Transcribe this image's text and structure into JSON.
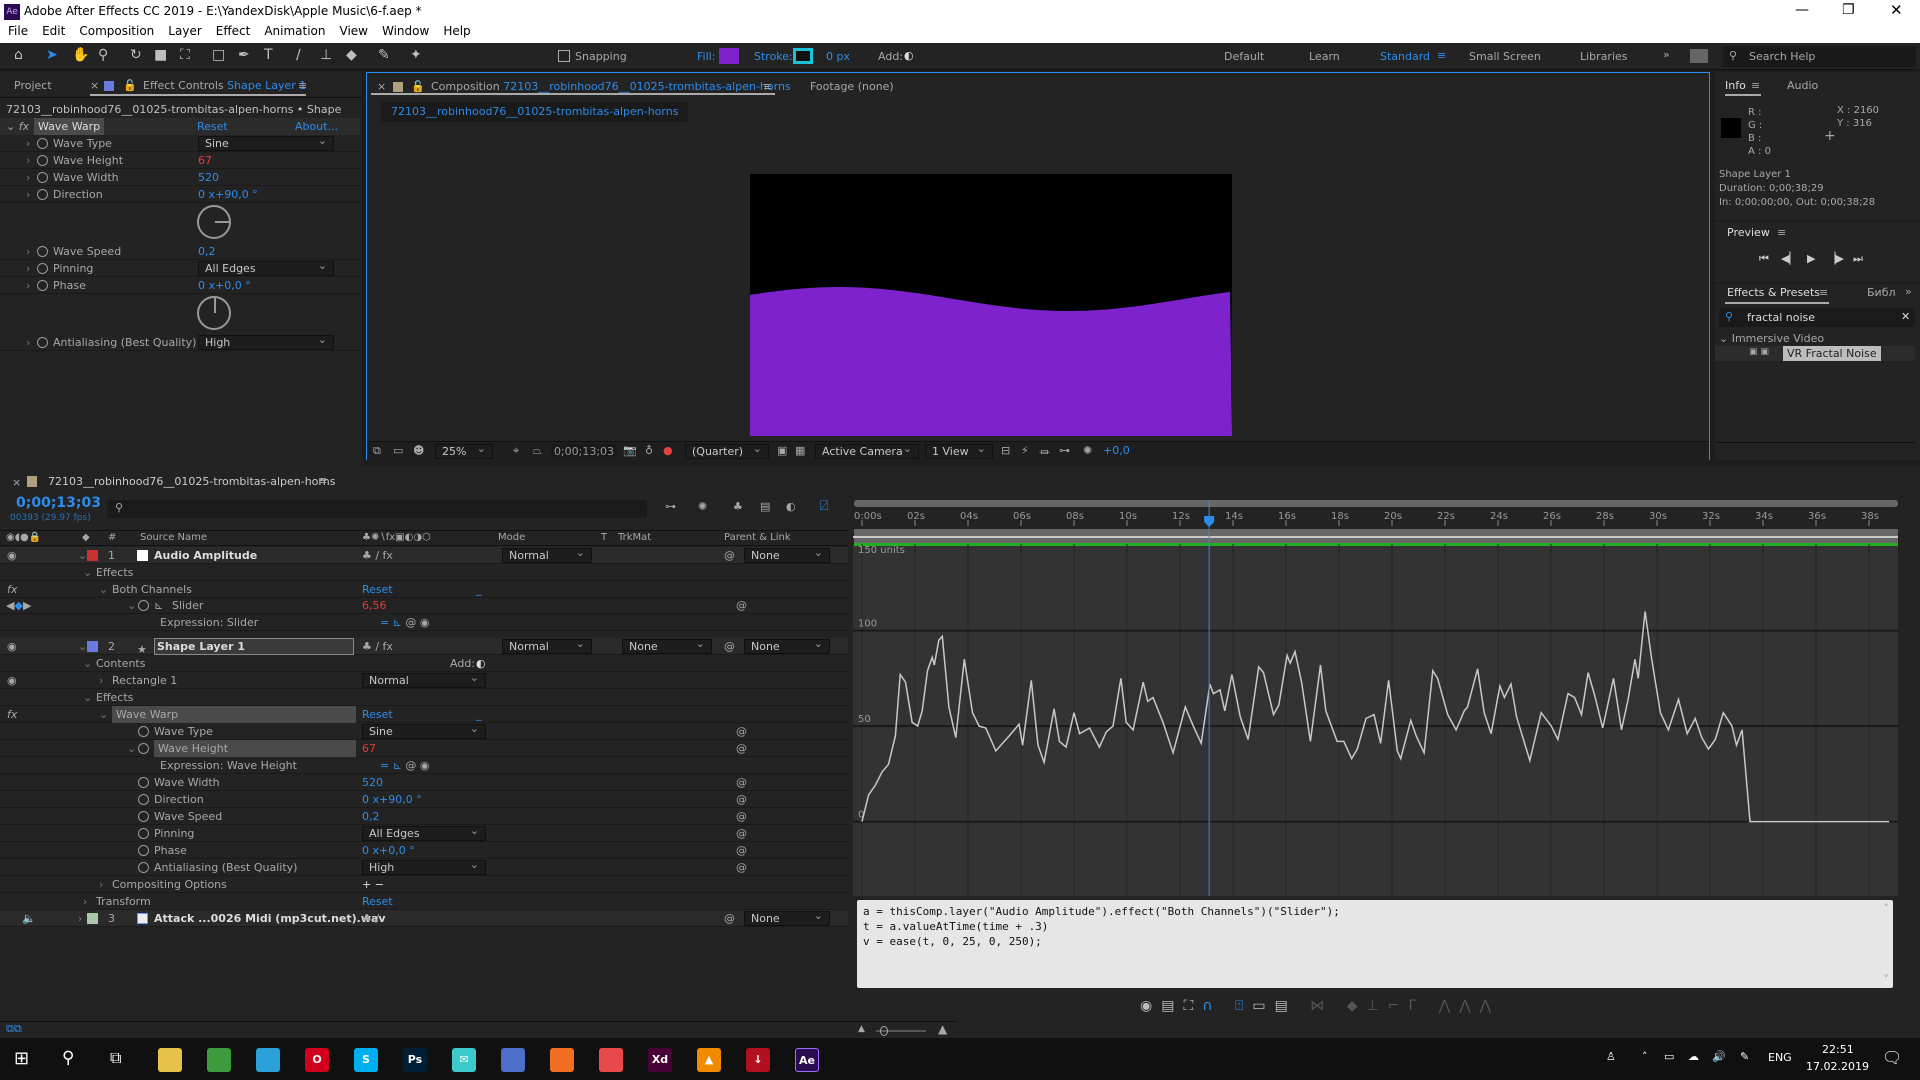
{
  "window": {
    "title": "Adobe After Effects CC 2019 - E:\\YandexDisk\\Apple Music\\6-f.aep *",
    "app_icon": "Ae"
  },
  "menu": [
    "File",
    "Edit",
    "Composition",
    "Layer",
    "Effect",
    "Animation",
    "View",
    "Window",
    "Help"
  ],
  "toolbar": {
    "snapping": "Snapping",
    "fill_label": "Fill:",
    "fill_color": "#7d22cc",
    "stroke_label": "Stroke:",
    "stroke_color": "#19c2d6",
    "stroke_width": "0 px",
    "add_label": "Add:",
    "workspaces": [
      "Default",
      "Learn",
      "Standard",
      "Small Screen",
      "Libraries"
    ],
    "active_workspace": "Standard",
    "search_help": "Search Help"
  },
  "effect_controls": {
    "tab_project": "Project",
    "tab_label": "Effect Controls",
    "tab_layer": "Shape Layer 1",
    "breadcrumb": "72103__robinhood76__01025-trombitas-alpen-horns • Shape Layer 1",
    "effect": "Wave Warp",
    "reset": "Reset",
    "about": "About...",
    "props": [
      {
        "name": "Wave Type",
        "value": "Sine",
        "kind": "dropdown"
      },
      {
        "name": "Wave Height",
        "value": "67",
        "kind": "red"
      },
      {
        "name": "Wave Width",
        "value": "520",
        "kind": "num"
      },
      {
        "name": "Direction",
        "value": "0 x+90,0 °",
        "kind": "num"
      },
      {
        "name": "Wave Speed",
        "value": "0,2",
        "kind": "num"
      },
      {
        "name": "Pinning",
        "value": "All Edges",
        "kind": "dropdown"
      },
      {
        "name": "Phase",
        "value": "0 x+0,0 °",
        "kind": "num"
      },
      {
        "name": "Antialiasing (Best Quality)",
        "value": "High",
        "kind": "dropdown"
      }
    ]
  },
  "composition": {
    "tab_label": "Composition",
    "comp_name": "72103__robinhood76__01025-trombitas-alpen-horns",
    "footage_tab": "Footage (none)",
    "wave_color": "#7d22cc",
    "zoom": "25%",
    "timecode": "0;00;13;03",
    "resolution": "(Quarter)",
    "camera": "Active Camera",
    "views": "1 View",
    "exposure": "+0,0"
  },
  "info": {
    "tab": "Info",
    "tab2": "Audio",
    "r": "R :",
    "g": "G :",
    "b": "B :",
    "a": "A :  0",
    "x": "X : 2160",
    "y": "Y : 316",
    "layer": "Shape Layer 1",
    "duration": "Duration: 0;00;38;29",
    "inout": "In: 0;00;00;00, Out: 0;00;38;28"
  },
  "preview": {
    "title": "Preview"
  },
  "effects_presets": {
    "tab": "Effects & Presets",
    "tab2": "Библ",
    "search": "fractal noise",
    "category": "Immersive Video",
    "item": "VR Fractal Noise"
  },
  "timeline": {
    "comp_name": "72103__robinhood76__01025-trombitas-alpen-horns",
    "timecode": "0;00;13;03",
    "frames": "00393 (29.97 fps)",
    "headers": {
      "num": "#",
      "source": "Source Name",
      "mode": "Mode",
      "t": "T",
      "trkmat": "TrkMat",
      "parent": "Parent & Link"
    },
    "rows": [
      {
        "indent": 0,
        "num": "1",
        "label_color": "#c83232",
        "name": "Audio Amplitude",
        "mode": "Normal",
        "parent": "None",
        "layer": true,
        "eye": true
      },
      {
        "indent": 1,
        "name": "Effects"
      },
      {
        "indent": 2,
        "name": "Both Channels",
        "value": "Reset",
        "vclass": "blue",
        "fx": true
      },
      {
        "indent": 3,
        "name": "Slider",
        "value": "6,56",
        "vclass": "red",
        "kf": true,
        "stopwatch": true
      },
      {
        "indent": 4,
        "name": "Expression: Slider",
        "expr": true
      },
      {
        "indent": 0,
        "num": "2",
        "label_color": "#6a7be0",
        "name": "Shape Layer 1",
        "mode": "Normal",
        "trkmat": "None",
        "parent": "None",
        "layer": true,
        "eye": true,
        "selected": true
      },
      {
        "indent": 1,
        "name": "Contents",
        "add": "Add:"
      },
      {
        "indent": 2,
        "name": "Rectangle 1",
        "dropdown": "Normal",
        "eye": true
      },
      {
        "indent": 1,
        "name": "Effects"
      },
      {
        "indent": 2,
        "name": "Wave Warp",
        "value": "Reset",
        "vclass": "blue",
        "fx": true,
        "hl": true
      },
      {
        "indent": 3,
        "name": "Wave Type",
        "dropdown": "Sine",
        "stopwatch": true
      },
      {
        "indent": 3,
        "name": "Wave Height",
        "value": "67",
        "vclass": "red",
        "stopwatch": true,
        "hl": true
      },
      {
        "indent": 4,
        "name": "Expression: Wave Height",
        "expr": true
      },
      {
        "indent": 3,
        "name": "Wave Width",
        "value": "520",
        "vclass": "blue",
        "stopwatch": true
      },
      {
        "indent": 3,
        "name": "Direction",
        "value": "0 x+90,0 °",
        "vclass": "blue",
        "stopwatch": true
      },
      {
        "indent": 3,
        "name": "Wave Speed",
        "value": "0,2",
        "vclass": "blue",
        "stopwatch": true
      },
      {
        "indent": 3,
        "name": "Pinning",
        "dropdown": "All Edges",
        "stopwatch": true
      },
      {
        "indent": 3,
        "name": "Phase",
        "value": "0 x+0,0 °",
        "vclass": "blue",
        "stopwatch": true
      },
      {
        "indent": 3,
        "name": "Antialiasing (Best Quality)",
        "dropdown": "High",
        "stopwatch": true
      },
      {
        "indent": 2,
        "name": "Compositing Options",
        "plusminus": "+ −"
      },
      {
        "indent": 1,
        "name": "Transform",
        "value": "Reset",
        "vclass": "blue"
      },
      {
        "indent": 0,
        "num": "3",
        "label_color": "#a8c8a8",
        "name": "Attack ...0026 Midi (mp3cut.net).wav",
        "parent": "None",
        "layer": true,
        "audio": true
      }
    ]
  },
  "graph": {
    "ruler_labels": [
      "0:00s",
      "02s",
      "04s",
      "06s",
      "08s",
      "10s",
      "12s",
      "14s",
      "16s",
      "18s",
      "20s",
      "22s",
      "24s",
      "26s",
      "28s",
      "30s",
      "32s",
      "34s",
      "36s",
      "38s"
    ],
    "top_label": "150 units",
    "y_labels": [
      "100",
      "50",
      "0"
    ],
    "playhead_s": 13.1,
    "curve": [
      [
        0,
        0
      ],
      [
        0.25,
        14
      ],
      [
        0.5,
        19
      ],
      [
        0.76,
        26
      ],
      [
        1.0,
        30
      ],
      [
        1.26,
        45
      ],
      [
        1.44,
        77
      ],
      [
        1.64,
        73
      ],
      [
        1.89,
        52
      ],
      [
        2.1,
        50
      ],
      [
        2.27,
        58
      ],
      [
        2.47,
        79
      ],
      [
        2.65,
        86
      ],
      [
        2.73,
        82
      ],
      [
        2.9,
        95
      ],
      [
        3.03,
        97
      ],
      [
        3.28,
        60
      ],
      [
        3.54,
        44
      ],
      [
        3.86,
        85
      ],
      [
        4.17,
        57
      ],
      [
        4.42,
        50
      ],
      [
        4.67,
        49
      ],
      [
        5.05,
        37
      ],
      [
        5.56,
        45
      ],
      [
        5.93,
        51
      ],
      [
        6.06,
        40
      ],
      [
        6.39,
        74
      ],
      [
        6.64,
        40
      ],
      [
        6.87,
        31
      ],
      [
        7.25,
        59
      ],
      [
        7.45,
        42
      ],
      [
        7.7,
        39
      ],
      [
        8.0,
        57
      ],
      [
        8.21,
        46
      ],
      [
        8.59,
        49
      ],
      [
        8.96,
        39
      ],
      [
        9.22,
        47
      ],
      [
        9.47,
        50
      ],
      [
        9.77,
        75
      ],
      [
        9.97,
        52
      ],
      [
        10.23,
        48
      ],
      [
        10.61,
        73
      ],
      [
        10.78,
        63
      ],
      [
        10.98,
        65
      ],
      [
        11.36,
        52
      ],
      [
        11.74,
        36
      ],
      [
        12.2,
        60
      ],
      [
        12.5,
        50
      ],
      [
        12.8,
        41
      ],
      [
        13.13,
        72
      ],
      [
        13.26,
        67
      ],
      [
        13.51,
        69
      ],
      [
        13.69,
        58
      ],
      [
        13.96,
        77
      ],
      [
        14.27,
        55
      ],
      [
        14.57,
        43
      ],
      [
        14.97,
        81
      ],
      [
        15.15,
        78
      ],
      [
        15.53,
        56
      ],
      [
        15.73,
        61
      ],
      [
        16.04,
        87
      ],
      [
        16.16,
        83
      ],
      [
        16.34,
        89
      ],
      [
        16.59,
        73
      ],
      [
        16.92,
        42
      ],
      [
        17.3,
        82
      ],
      [
        17.5,
        58
      ],
      [
        17.93,
        42
      ],
      [
        18.18,
        42
      ],
      [
        18.48,
        33
      ],
      [
        18.69,
        38
      ],
      [
        19.02,
        54
      ],
      [
        19.32,
        56
      ],
      [
        19.57,
        41
      ],
      [
        19.87,
        74
      ],
      [
        20.2,
        37
      ],
      [
        20.33,
        33
      ],
      [
        20.71,
        53
      ],
      [
        20.91,
        45
      ],
      [
        21.21,
        36
      ],
      [
        21.54,
        79
      ],
      [
        21.72,
        75
      ],
      [
        22.1,
        56
      ],
      [
        22.42,
        48
      ],
      [
        22.73,
        58
      ],
      [
        22.85,
        60
      ],
      [
        23.23,
        80
      ],
      [
        23.48,
        57
      ],
      [
        23.74,
        46
      ],
      [
        24.07,
        71
      ],
      [
        24.24,
        65
      ],
      [
        24.49,
        72
      ],
      [
        24.7,
        55
      ],
      [
        25.2,
        32
      ],
      [
        25.63,
        57
      ],
      [
        26.01,
        50
      ],
      [
        26.26,
        43
      ],
      [
        26.64,
        67
      ],
      [
        26.89,
        65
      ],
      [
        27.15,
        56
      ],
      [
        27.4,
        78
      ],
      [
        27.65,
        66
      ],
      [
        27.95,
        49
      ],
      [
        28.36,
        75
      ],
      [
        28.66,
        48
      ],
      [
        28.91,
        64
      ],
      [
        29.17,
        85
      ],
      [
        29.29,
        75
      ],
      [
        29.55,
        110
      ],
      [
        29.8,
        85
      ],
      [
        30.13,
        57
      ],
      [
        30.43,
        48
      ],
      [
        30.81,
        64
      ],
      [
        31.14,
        46
      ],
      [
        31.44,
        54
      ],
      [
        31.69,
        44
      ],
      [
        31.94,
        38
      ],
      [
        32.2,
        43
      ],
      [
        32.5,
        57
      ],
      [
        32.83,
        50
      ],
      [
        33.0,
        40
      ],
      [
        33.21,
        48
      ],
      [
        33.51,
        0
      ],
      [
        38.76,
        0
      ]
    ],
    "expression": [
      "a = thisComp.layer(\"Audio Amplitude\").effect(\"Both Channels\")(\"Slider\");",
      "t = a.valueAtTime(time + .3)",
      "v = ease(t, 0, 25, 0, 250);"
    ]
  },
  "taskbar": {
    "apps": [
      {
        "label": "",
        "color": "#e8c14a"
      },
      {
        "label": "",
        "color": "#3c9b3c"
      },
      {
        "label": "",
        "color": "#2aa0d8"
      },
      {
        "label": "O",
        "color": "#d1001c"
      },
      {
        "label": "S",
        "color": "#00aff0"
      },
      {
        "label": "Ps",
        "color": "#001e36"
      },
      {
        "label": "✉",
        "color": "#3bc9c9"
      },
      {
        "label": "",
        "color": "#4b6fc9"
      },
      {
        "label": "",
        "color": "#f16e22"
      },
      {
        "label": "",
        "color": "#e8494b"
      },
      {
        "label": "Xd",
        "color": "#470137"
      },
      {
        "label": "▲",
        "color": "#f08a00"
      },
      {
        "label": "↓",
        "color": "#b01020"
      },
      {
        "label": "Ae",
        "color": "#2a0a50"
      }
    ],
    "lang": "ENG",
    "time": "22:51",
    "date": "17.02.2019"
  }
}
